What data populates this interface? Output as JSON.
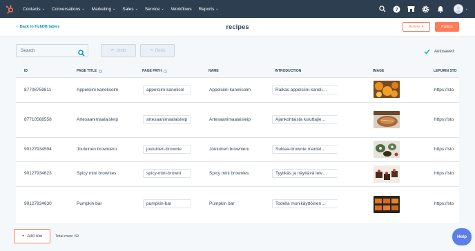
{
  "nav": {
    "items": [
      {
        "label": "Contacts",
        "has_menu": true
      },
      {
        "label": "Conversations",
        "has_menu": true
      },
      {
        "label": "Marketing",
        "has_menu": true
      },
      {
        "label": "Sales",
        "has_menu": true
      },
      {
        "label": "Service",
        "has_menu": true
      },
      {
        "label": "Workflows",
        "has_menu": false
      },
      {
        "label": "Reports",
        "has_menu": true
      }
    ],
    "chevron": "⌄",
    "icons": [
      "search-icon",
      "help-icon",
      "marketplace-icon",
      "settings-icon",
      "notifications-icon"
    ]
  },
  "header": {
    "back_label": "Back to HubDB tables",
    "title": "recipes",
    "actions_label": "Actions",
    "publish_label": "Publish"
  },
  "toolbar": {
    "search_placeholder": "Search",
    "undo_label": "Undo",
    "redo_label": "Redo",
    "status": "Autosaved"
  },
  "table": {
    "columns": [
      "ID",
      "PAGE TITLE",
      "PAGE PATH",
      "NAME",
      "INTRODUCTION",
      "IMAGE",
      "LEPURIN STO"
    ],
    "rows": [
      {
        "id": "87708759811",
        "page_title": "Appelsiini kanelisolm",
        "page_path": "appelsiini-kanelisol",
        "name": "Appelsiini kanelisolm",
        "intro": "Raikas appelsiini-kaneli…",
        "url": "https://sto",
        "image": "oranges"
      },
      {
        "id": "87710568558",
        "page_title": "Artesaanimaalaisleip",
        "page_path": "artesaanimaalaisleip",
        "name": "Artesaanimaalaisleip",
        "intro": "Ajankohtaista kuluttajie…",
        "url": "https://sto",
        "image": "bread"
      },
      {
        "id": "90127934594",
        "page_title": "Jouluinen brownieru",
        "page_path": "jouluinen-brownie",
        "name": "Jouluinen brownieru",
        "intro": "Suklaa-brownie mantel…",
        "url": "https://sto",
        "image": "christmas"
      },
      {
        "id": "90127934623",
        "page_title": "Spicy mini brownies",
        "page_path": "spicy-mini-browni",
        "name": "Spicy mini brownies",
        "intro": "Tyylikäs ja näyttävä leiv…",
        "url": "https://sto",
        "image": "brownies"
      },
      {
        "id": "90127934630",
        "page_title": "Pumpkin bar",
        "page_path": "pumpkin-bar",
        "name": "Pumpkin bar",
        "intro": "Todella monikäyttöinen…",
        "url": "https://sto",
        "image": "pumpkin"
      }
    ]
  },
  "footer": {
    "add_row_label": "Add row",
    "total_rows": "Total rows: 69",
    "help_label": "Help"
  },
  "colors": {
    "nav_bg": "#2d3e50",
    "accent": "#ff7a59",
    "link": "#0091ae",
    "success": "#00bda5",
    "help": "#5c7ee8"
  }
}
